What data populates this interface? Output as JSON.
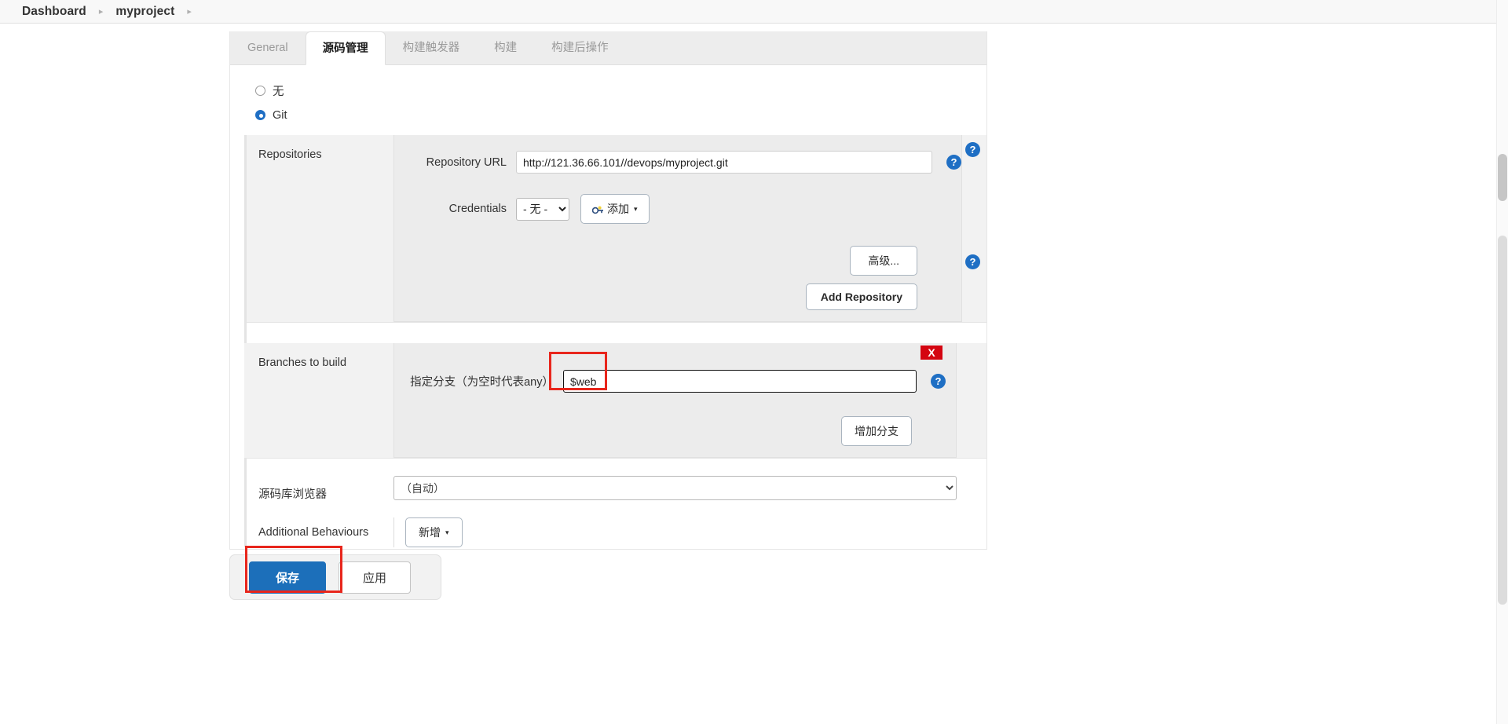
{
  "breadcrumb": {
    "items": [
      {
        "label": "Dashboard"
      },
      {
        "label": "myproject"
      }
    ],
    "separator": "▸"
  },
  "tabs": [
    {
      "label": "General",
      "active": false
    },
    {
      "label": "源码管理",
      "active": true
    },
    {
      "label": "构建触发器",
      "active": false
    },
    {
      "label": "构建",
      "active": false
    },
    {
      "label": "构建后操作",
      "active": false
    }
  ],
  "scm": {
    "radio_none_label": "无",
    "radio_git_label": "Git",
    "selected": "Git",
    "repositories": {
      "section_label": "Repositories",
      "url_label": "Repository URL",
      "url_value": "http://121.36.66.101//devops/myproject.git",
      "credentials_label": "Credentials",
      "credentials_value": "- 无 -",
      "credentials_options": [
        "- 无 -"
      ],
      "add_credentials_label": "添加",
      "advanced_label": "高级...",
      "add_repository_label": "Add Repository",
      "help_label": "?"
    },
    "branches": {
      "section_label": "Branches to build",
      "branch_label": "指定分支（为空时代表any）",
      "branch_value": "$web",
      "add_branch_label": "增加分支",
      "delete_badge_label": "X",
      "help_label": "?"
    },
    "browser": {
      "label": "源码库浏览器",
      "value": "（自动）",
      "options": [
        "（自动）"
      ],
      "help_label": "?"
    },
    "additional_behaviours": {
      "label": "Additional Behaviours",
      "add_label": "新增"
    }
  },
  "footer": {
    "save_label": "保存",
    "apply_label": "应用"
  },
  "icons": {
    "key": "key-icon",
    "caret_down": "▾",
    "chevron_down": "chevron-down-icon"
  },
  "colors": {
    "accent": "#1f6fc4",
    "annotation": "#e8261c",
    "delete_badge": "#d40511",
    "save_button": "#1c6fba"
  }
}
